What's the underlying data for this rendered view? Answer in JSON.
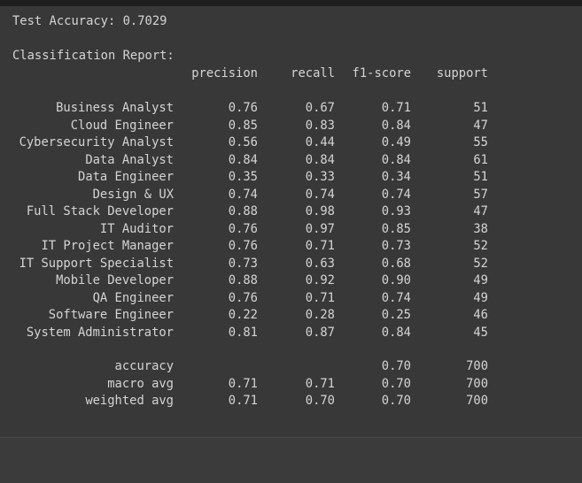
{
  "accuracy_line": "Test Accuracy: 0.7029",
  "report_title": "Classification Report:",
  "headers": [
    "precision",
    "recall",
    "f1-score",
    "support"
  ],
  "rows": [
    {
      "label": "Business Analyst",
      "precision": "0.76",
      "recall": "0.67",
      "f1": "0.71",
      "support": "51"
    },
    {
      "label": "Cloud Engineer",
      "precision": "0.85",
      "recall": "0.83",
      "f1": "0.84",
      "support": "47"
    },
    {
      "label": "Cybersecurity Analyst",
      "precision": "0.56",
      "recall": "0.44",
      "f1": "0.49",
      "support": "55"
    },
    {
      "label": "Data Analyst",
      "precision": "0.84",
      "recall": "0.84",
      "f1": "0.84",
      "support": "61"
    },
    {
      "label": "Data Engineer",
      "precision": "0.35",
      "recall": "0.33",
      "f1": "0.34",
      "support": "51"
    },
    {
      "label": "Design & UX",
      "precision": "0.74",
      "recall": "0.74",
      "f1": "0.74",
      "support": "57"
    },
    {
      "label": "Full Stack Developer",
      "precision": "0.88",
      "recall": "0.98",
      "f1": "0.93",
      "support": "47"
    },
    {
      "label": "IT Auditor",
      "precision": "0.76",
      "recall": "0.97",
      "f1": "0.85",
      "support": "38"
    },
    {
      "label": "IT Project Manager",
      "precision": "0.76",
      "recall": "0.71",
      "f1": "0.73",
      "support": "52"
    },
    {
      "label": "IT Support Specialist",
      "precision": "0.73",
      "recall": "0.63",
      "f1": "0.68",
      "support": "52"
    },
    {
      "label": "Mobile Developer",
      "precision": "0.88",
      "recall": "0.92",
      "f1": "0.90",
      "support": "49"
    },
    {
      "label": "QA Engineer",
      "precision": "0.76",
      "recall": "0.71",
      "f1": "0.74",
      "support": "49"
    },
    {
      "label": "Software Engineer",
      "precision": "0.22",
      "recall": "0.28",
      "f1": "0.25",
      "support": "46"
    },
    {
      "label": "System Administrator",
      "precision": "0.81",
      "recall": "0.87",
      "f1": "0.84",
      "support": "45"
    }
  ],
  "summary": [
    {
      "label": "accuracy",
      "precision": "",
      "recall": "",
      "f1": "0.70",
      "support": "700"
    },
    {
      "label": "macro avg",
      "precision": "0.71",
      "recall": "0.71",
      "f1": "0.70",
      "support": "700"
    },
    {
      "label": "weighted avg",
      "precision": "0.71",
      "recall": "0.70",
      "f1": "0.70",
      "support": "700"
    }
  ]
}
